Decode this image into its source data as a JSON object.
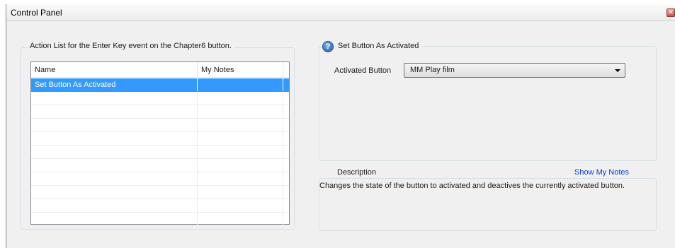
{
  "window": {
    "title": "Control Panel",
    "close_glyph": "✕"
  },
  "action_list": {
    "legend": "Action List for the Enter Key event on the Chapter6 button.",
    "columns": [
      "Name",
      "My Notes"
    ],
    "rows": [
      {
        "name": "Set Button As Activated",
        "notes": "",
        "selected": true
      },
      {
        "name": "",
        "notes": ""
      },
      {
        "name": "",
        "notes": ""
      },
      {
        "name": "",
        "notes": ""
      },
      {
        "name": "",
        "notes": ""
      },
      {
        "name": "",
        "notes": ""
      },
      {
        "name": "",
        "notes": ""
      },
      {
        "name": "",
        "notes": ""
      },
      {
        "name": "",
        "notes": ""
      },
      {
        "name": "",
        "notes": ""
      },
      {
        "name": "",
        "notes": ""
      }
    ]
  },
  "properties": {
    "icon": "help-icon",
    "icon_glyph": "?",
    "title": "Set Button As Activated",
    "activated_button_label": "Activated Button",
    "activated_button_value": "MM Play film"
  },
  "description": {
    "label": "Description",
    "show_notes_link": "Show My Notes",
    "text": "Changes the state of the button to activated and deactives the currently activated button."
  },
  "colors": {
    "selection": "#3399ff",
    "link": "#0a3be0",
    "panel_bg": "#f0f0f0"
  }
}
